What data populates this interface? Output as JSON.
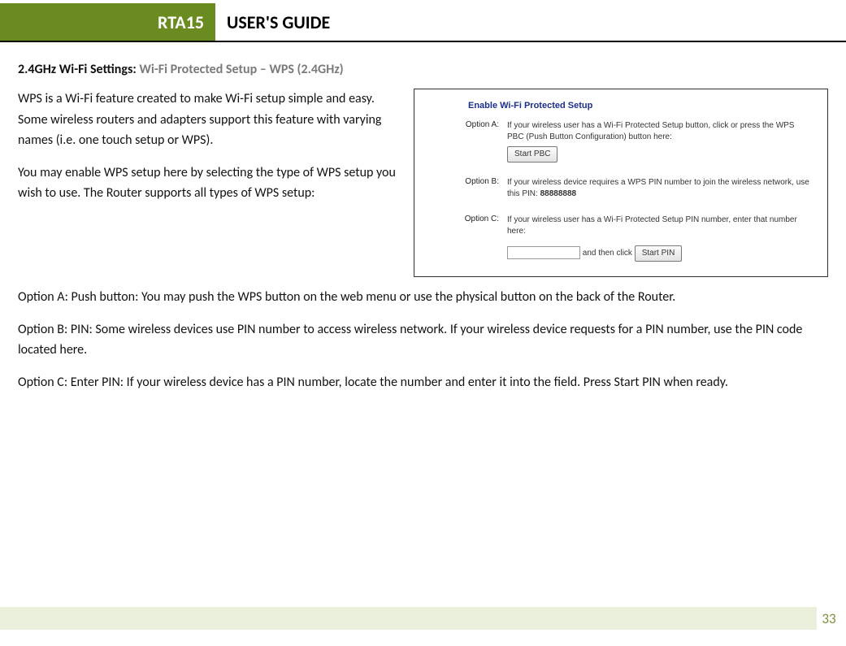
{
  "header": {
    "brand": "RTA15",
    "title": "USER'S GUIDE"
  },
  "section": {
    "bold": "2.4GHz Wi-Fi Settings: ",
    "rest": "Wi-Fi Protected Setup – WPS (2.4GHz)"
  },
  "intro": {
    "p1": "WPS is a Wi-Fi feature created to make Wi-Fi setup simple and easy.  Some wireless routers and adapters support this feature with varying names (i.e. one touch setup or WPS).",
    "p2": "You may enable WPS setup here by selecting the type of WPS setup you wish to use.  The Router supports all types of WPS setup:"
  },
  "screenshot": {
    "title": "Enable Wi-Fi Protected Setup",
    "a": {
      "label": "Option A:",
      "text": "If your wireless user has a Wi-Fi Protected Setup button, click or press the WPS PBC (Push Button Configuration) button here:",
      "btn": "Start PBC"
    },
    "b": {
      "label": "Option B:",
      "text_pre": "If your wireless device requires a WPS PIN number to join the wireless network, use this PIN: ",
      "pin": "88888888"
    },
    "c": {
      "label": "Option C:",
      "text": "If your wireless user has a Wi-Fi Protected Setup PIN number, enter that number here:",
      "mid": " and then click ",
      "btn": "Start PIN"
    }
  },
  "paras": {
    "a": "Option A: Push button: You may push the WPS button on the web menu or use the physical button on the back of the Router.",
    "b": "Option B: PIN: Some wireless devices use PIN number to access wireless network.  If your wireless device requests for a PIN number, use the PIN code located here.",
    "c": "Option C: Enter PIN: If your wireless device has a PIN number, locate the number and enter it into the field.  Press Start PIN when ready."
  },
  "page_number": "33"
}
